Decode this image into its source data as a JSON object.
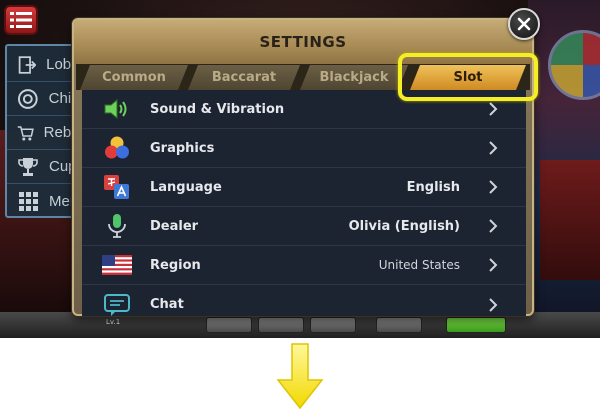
{
  "menu": {
    "items": [
      {
        "label": "Lobby",
        "icon": "exit-door-icon"
      },
      {
        "label": "Chips",
        "icon": "chips-icon"
      },
      {
        "label": "Rebuy",
        "icon": "cart-icon"
      },
      {
        "label": "Cup",
        "icon": "trophy-icon"
      },
      {
        "label": "Menu",
        "icon": "grid-icon"
      }
    ]
  },
  "settings": {
    "title": "SETTINGS",
    "tabs": [
      {
        "label": "Common",
        "active": false
      },
      {
        "label": "Baccarat",
        "active": false
      },
      {
        "label": "Blackjack",
        "active": false
      },
      {
        "label": "Slot",
        "active": true
      }
    ],
    "rows": [
      {
        "label": "Sound & Vibration",
        "value": "",
        "icon": "speaker-icon"
      },
      {
        "label": "Graphics",
        "value": "",
        "icon": "color-circles-icon"
      },
      {
        "label": "Language",
        "value": "English",
        "icon": "translate-icon"
      },
      {
        "label": "Dealer",
        "value": "Olivia (English)",
        "icon": "microphone-icon"
      },
      {
        "label": "Region",
        "value": "United States",
        "icon": "us-flag-icon"
      },
      {
        "label": "Chat",
        "value": "",
        "icon": "chat-bubble-icon"
      }
    ]
  },
  "game": {
    "level_badge": "Lv.1"
  },
  "colors": {
    "highlight": "#f4ee27",
    "active_tab": "#e8a635",
    "list_bg": "#1c2331"
  }
}
